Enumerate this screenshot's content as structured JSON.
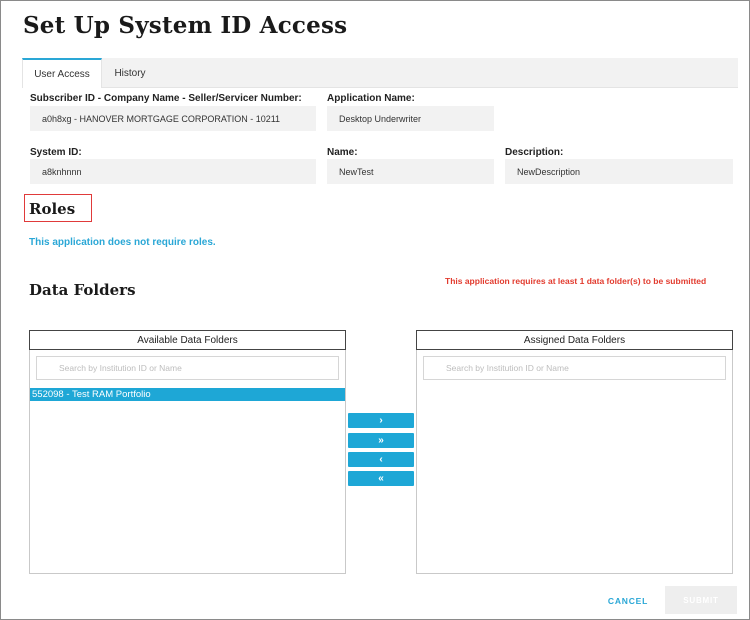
{
  "page": {
    "title": "Set Up System ID Access"
  },
  "tabs": [
    {
      "label": "User Access",
      "active": true
    },
    {
      "label": "History",
      "active": false
    }
  ],
  "fields": {
    "subscriber": {
      "label": "Subscriber ID - Company Name - Seller/Servicer Number:",
      "value": "a0h8xg - HANOVER MORTGAGE CORPORATION - 10211"
    },
    "application": {
      "label": "Application Name:",
      "value": "Desktop Underwriter"
    },
    "system_id": {
      "label": "System ID:",
      "value": "a8knhnnn"
    },
    "name": {
      "label": "Name:",
      "value": "NewTest"
    },
    "description": {
      "label": "Description:",
      "value": "NewDescription"
    }
  },
  "roles": {
    "heading": "Roles",
    "message": "This application does not require roles."
  },
  "data_folders": {
    "heading": "Data Folders",
    "warning": "This application requires at least 1 data folder(s) to be submitted",
    "available": {
      "header": "Available Data Folders",
      "search_placeholder": "Search by Institution ID or Name",
      "items": [
        "552098 - Test RAM Portfolio"
      ]
    },
    "assigned": {
      "header": "Assigned Data Folders",
      "search_placeholder": "Search by Institution ID or Name",
      "items": []
    },
    "transfer": {
      "add_one": "›",
      "add_all": "»",
      "remove_one": "‹",
      "remove_all": "«"
    }
  },
  "actions": {
    "cancel": "CANCEL",
    "submit": "SUBMIT"
  },
  "colors": {
    "accent": "#1ea7d6",
    "warning": "#e23b2e",
    "field_bg": "#f2f2f2"
  }
}
